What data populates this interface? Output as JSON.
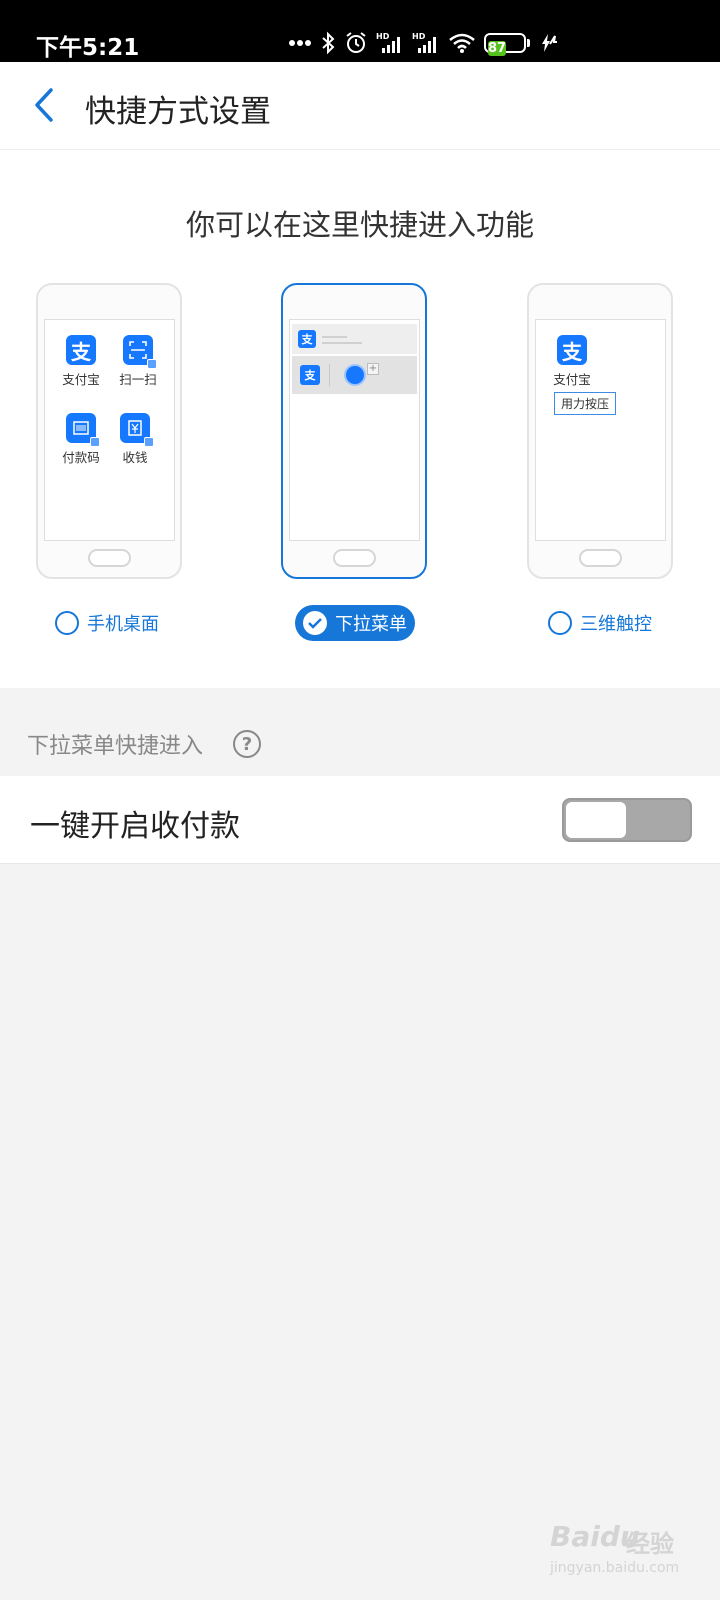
{
  "status_bar": {
    "time": "下午5:21",
    "battery": "87",
    "icons": [
      "more-dots-icon",
      "bluetooth-icon",
      "alarm-icon",
      "signal-hd-icon",
      "signal-hd-icon",
      "wifi-icon",
      "battery-icon",
      "charging-icon"
    ]
  },
  "header": {
    "title": "快捷方式设置"
  },
  "chooser": {
    "heading": "你可以在这里快捷进入功能",
    "desktop_preview": {
      "apps": [
        {
          "label": "支付宝",
          "icon": "alipay-icon"
        },
        {
          "label": "扫一扫",
          "icon": "scan-icon"
        },
        {
          "label": "付款码",
          "icon": "paycode-icon"
        },
        {
          "label": "收钱",
          "icon": "receive-money-icon"
        }
      ]
    },
    "touch_preview": {
      "app_label": "支付宝",
      "tooltip": "用力按压"
    },
    "options": [
      {
        "label": "手机桌面",
        "selected": false
      },
      {
        "label": "下拉菜单",
        "selected": true
      },
      {
        "label": "三维触控",
        "selected": false
      }
    ]
  },
  "section": {
    "label": "下拉菜单快捷进入"
  },
  "setting": {
    "label": "一键开启收付款",
    "toggle_on": false
  },
  "watermark": {
    "brand": "Baidu",
    "text": "经验",
    "url": "jingyan.baidu.com"
  },
  "colors": {
    "accent": "#1677d9",
    "alipay_blue": "#1677ff",
    "battery_green": "#56c21c"
  }
}
